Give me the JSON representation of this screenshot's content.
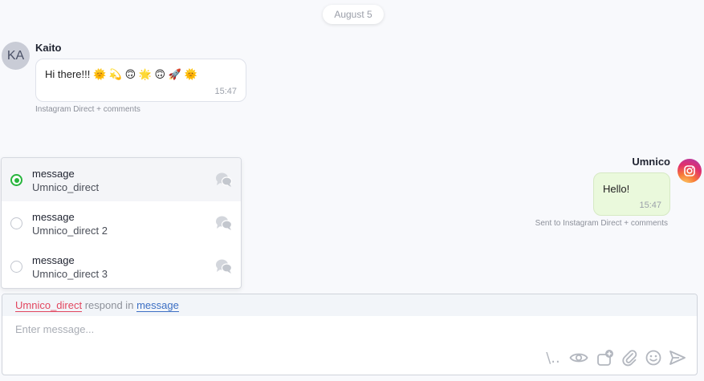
{
  "date_divider": "August 5",
  "incoming": {
    "avatar_initials": "KA",
    "sender": "Kaito",
    "text": "Hi there!!! 🌞 💫 🙃 🌟 🙃 🚀 🌞",
    "time": "15:47",
    "channel_note": "Instagram Direct + comments"
  },
  "outgoing": {
    "sender": "Umnico",
    "avatar_icon": "instagram-icon",
    "text": "Hello!",
    "time": "15:47",
    "channel_note": "Sent to Instagram Direct + comments"
  },
  "channel_options": [
    {
      "type": "message",
      "name": "Umnico_direct",
      "selected": true,
      "icon": "chat-bubbles-icon"
    },
    {
      "type": "message",
      "name": "Umnico_direct 2",
      "selected": false,
      "icon": "chat-bubbles-icon"
    },
    {
      "type": "message",
      "name": "Umnico_direct 3",
      "selected": false,
      "icon": "chat-bubbles-icon"
    }
  ],
  "composer": {
    "respond_account": "Umnico_direct",
    "respond_middle": "respond in",
    "respond_channel": "message",
    "placeholder": "Enter message...",
    "toolbar": {
      "templates_label": "\\..",
      "icons": [
        "templates-icon",
        "eye-icon",
        "add-product-icon",
        "paperclip-icon",
        "emoji-icon",
        "send-icon"
      ]
    }
  },
  "colors": {
    "accent_green": "#27b53d",
    "account_link": "#e2465f",
    "channel_link": "#3c6fc4",
    "outgoing_bubble": "#eaf9dc"
  }
}
